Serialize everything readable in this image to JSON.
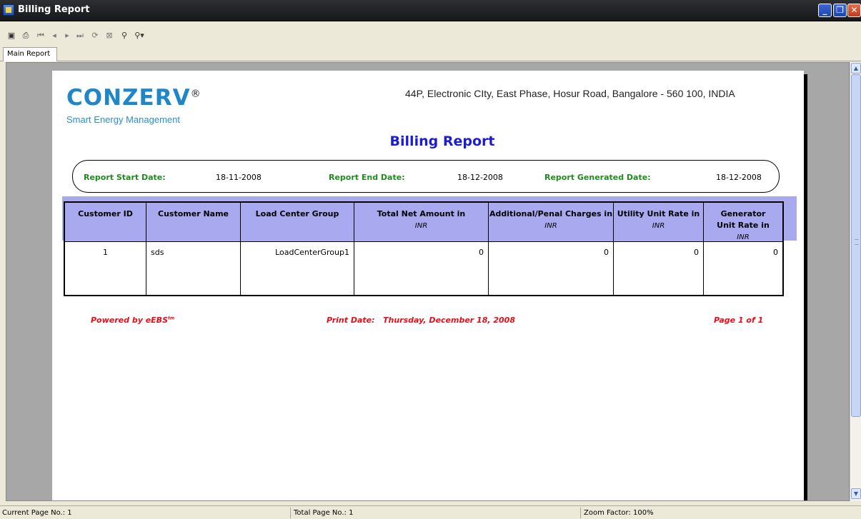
{
  "window": {
    "title": "Billing Report"
  },
  "tabs": [
    {
      "label": "Main Report"
    }
  ],
  "toolbar": {
    "buttons": [
      "export-icon",
      "print-icon",
      "first-page-icon",
      "prev-page-icon",
      "next-page-icon",
      "last-page-icon",
      "refresh-icon",
      "stop-icon",
      "find-icon",
      "zoom-icon"
    ]
  },
  "report": {
    "logo_main": "CONZERV",
    "logo_registered": "®",
    "logo_sub": "Smart Energy Management",
    "address": "44P, Electronic CIty, East Phase, Hosur Road, Bangalore - 560 100, INDIA",
    "title": "Billing Report",
    "dates": {
      "start_label": "Report Start Date:",
      "start_value": "18-11-2008",
      "end_label": "Report End Date:",
      "end_value": "18-12-2008",
      "generated_label": "Report Generated Date:",
      "generated_value": "18-12-2008"
    },
    "table": {
      "headers": {
        "customer_id": "Customer ID",
        "customer_name": "Customer Name",
        "load_center_group": "Load Center Group",
        "total_net_amount": "Total Net Amount in",
        "total_net_amount_unit": "INR",
        "additional_charges": "Additional/Penal Charges in",
        "additional_charges_unit": "INR",
        "utility_rate": "Utility Unit Rate in",
        "utility_rate_unit": "INR",
        "generator_rate": "Generator Unit Rate in",
        "generator_rate_unit": "INR"
      },
      "rows": [
        {
          "customer_id": "1",
          "customer_name": "sds",
          "load_center_group": "LoadCenterGroup1",
          "total_net_amount": "0",
          "additional_charges": "0",
          "utility_rate": "0",
          "generator_rate": "0"
        }
      ]
    },
    "footer": {
      "powered_by": "Powered by eEBS",
      "powered_by_mark": "tm",
      "print_date_label": "Print Date:",
      "print_date_value": "Thursday, December 18, 2008",
      "page": "Page 1 of 1"
    }
  },
  "status": {
    "current_page": "Current Page No.: 1",
    "total_page": "Total Page No.: 1",
    "zoom": "Zoom Factor: 100%"
  }
}
